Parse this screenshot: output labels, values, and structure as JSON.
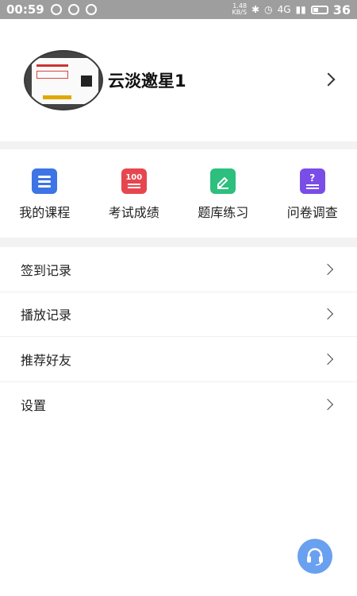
{
  "status_bar": {
    "time": "00:59",
    "net_speed_value": "1.48",
    "net_speed_unit": "KB/S",
    "signal_label": "4G",
    "battery_level": "36"
  },
  "profile": {
    "name": "云淡邀星1"
  },
  "functions": [
    {
      "label": "我的课程",
      "icon": "course-icon",
      "color": "#3d74e6"
    },
    {
      "label": "考试成绩",
      "icon": "score-icon",
      "icon_text": "100",
      "color": "#e6474f"
    },
    {
      "label": "题库练习",
      "icon": "question-bank-icon",
      "color": "#2cbf7e"
    },
    {
      "label": "问卷调查",
      "icon": "survey-icon",
      "icon_text": "?",
      "color": "#7a4de8"
    }
  ],
  "menu": [
    {
      "label": "签到记录"
    },
    {
      "label": "播放记录"
    },
    {
      "label": "推荐好友"
    },
    {
      "label": "设置"
    }
  ],
  "support_button": {
    "icon": "headset-icon",
    "color": "#6aa0f0"
  }
}
